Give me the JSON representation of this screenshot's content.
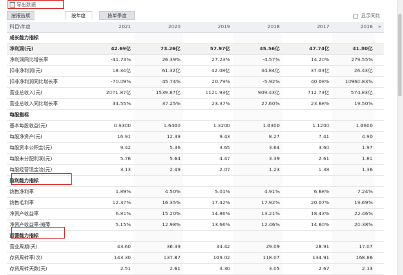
{
  "toolbar": {
    "export_label": "导出数据"
  },
  "tabs": [
    {
      "label": "按报告期",
      "active": false
    },
    {
      "label": "按年度",
      "active": true
    },
    {
      "label": "按单季度",
      "active": false
    }
  ],
  "compare": {
    "label": "显示同比",
    "checked": false
  },
  "table": {
    "header": [
      "科目\\年度",
      "2021",
      "2020",
      "2019",
      "2018",
      "2017",
      "2016"
    ],
    "nav_arrow": "»",
    "rows": [
      {
        "type": "section",
        "label": "成长能力指标",
        "values": []
      },
      {
        "type": "highlight",
        "label": "净利润(元)",
        "values": [
          "42.69亿",
          "73.26亿",
          "57.97亿",
          "45.56亿",
          "47.74亿",
          "41.80亿"
        ]
      },
      {
        "type": "data",
        "label": "净利润同比增长率",
        "values": [
          "-41.73%",
          "26.39%",
          "27.23%",
          "-4.57%",
          "14.20%",
          "279.55%"
        ]
      },
      {
        "type": "data",
        "label": "扣非净利润(元)",
        "values": [
          "18.34亿",
          "61.32亿",
          "42.08亿",
          "34.84亿",
          "37.03亿",
          "26.43亿"
        ]
      },
      {
        "type": "data",
        "label": "扣非净利润同比增长率",
        "values": [
          "-70.09%",
          "45.74%",
          "20.79%",
          "-5.92%",
          "40.08%",
          "10960.83%"
        ]
      },
      {
        "type": "data",
        "label": "营业总收入(元)",
        "values": [
          "2071.87亿",
          "1539.87亿",
          "1121.93亿",
          "909.43亿",
          "712.73亿",
          "574.83亿"
        ]
      },
      {
        "type": "data",
        "label": "营业总收入同比增长率",
        "values": [
          "34.55%",
          "37.25%",
          "23.37%",
          "27.60%",
          "23.68%",
          "19.50%"
        ]
      },
      {
        "type": "section",
        "label": "每股指标",
        "values": []
      },
      {
        "type": "data",
        "label": "基本每股收益(元)",
        "values": [
          "0.9300",
          "1.6400",
          "1.3200",
          "1.0300",
          "1.1200",
          "1.0600"
        ]
      },
      {
        "type": "data",
        "label": "每股净资产(元)",
        "values": [
          "16.91",
          "12.39",
          "9.43",
          "8.27",
          "7.41",
          "4.90"
        ]
      },
      {
        "type": "data",
        "label": "每股资本公积金(元)",
        "values": [
          "9.42",
          "5.36",
          "3.65",
          "3.64",
          "3.60",
          "1.97"
        ]
      },
      {
        "type": "data",
        "label": "每股未分配利润(元)",
        "values": [
          "5.76",
          "5.64",
          "4.47",
          "3.39",
          "2.61",
          "1.81"
        ]
      },
      {
        "type": "data",
        "label": "每股经营现金流(元)",
        "values": [
          "3.13",
          "2.49",
          "2.07",
          "1.23",
          "1.38",
          "1.36"
        ]
      },
      {
        "type": "section",
        "label": "盈利能力指标",
        "values": []
      },
      {
        "type": "data",
        "label": "销售净利率",
        "values": [
          "1.89%",
          "4.50%",
          "5.01%",
          "4.91%",
          "6.68%",
          "7.24%"
        ]
      },
      {
        "type": "data",
        "label": "销售毛利率",
        "values": [
          "12.37%",
          "16.35%",
          "17.42%",
          "17.92%",
          "20.07%",
          "19.69%"
        ]
      },
      {
        "type": "data",
        "label": "净资产收益率",
        "values": [
          "6.81%",
          "15.20%",
          "14.86%",
          "13.21%",
          "18.43%",
          "22.46%"
        ]
      },
      {
        "type": "data",
        "label": "净资产收益率-摊薄",
        "values": [
          "5.15%",
          "12.98%",
          "13.66%",
          "12.46%",
          "14.60%",
          "20.38%"
        ]
      },
      {
        "type": "section",
        "label": "运营能力指标",
        "values": []
      },
      {
        "type": "data",
        "label": "营业周期(天)",
        "values": [
          "43.60",
          "36.39",
          "34.42",
          "29.09",
          "28.91",
          "17.07"
        ]
      },
      {
        "type": "data",
        "label": "存货周转率(次)",
        "values": [
          "143.30",
          "137.87",
          "109.02",
          "118.07",
          "134.91",
          "168.86"
        ]
      },
      {
        "type": "data",
        "label": "存货周转天数(天)",
        "values": [
          "2.51",
          "2.61",
          "3.30",
          "3.05",
          "2.67",
          "2.13"
        ]
      }
    ]
  }
}
